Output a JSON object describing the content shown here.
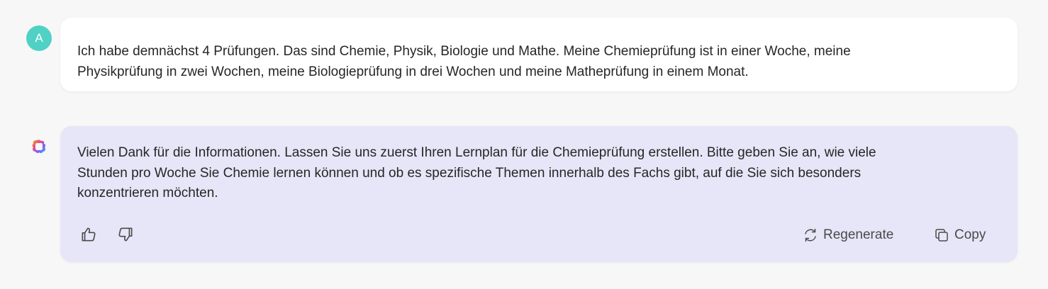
{
  "user": {
    "avatar_initial": "A",
    "message_line1": "Ich habe demnächst 4 Prüfungen. Das sind Chemie, Physik, Biologie und Mathe. Meine Chemieprüfung ist in einer Woche, meine",
    "message_line2": "Physikprüfung in zwei Wochen, meine Biologieprüfung in drei Wochen und meine Matheprüfung in einem Monat."
  },
  "assistant": {
    "logo_icon": "copilot-logo-icon",
    "message_line1": "Vielen Dank für die Informationen. Lassen Sie uns zuerst Ihren Lernplan für die Chemieprüfung erstellen. Bitte geben Sie an, wie viele",
    "message_line2": "Stunden pro Woche Sie Chemie lernen können und ob es spezifische Themen innerhalb des Fachs gibt, auf die Sie sich besonders",
    "message_line3": "konzentrieren möchten."
  },
  "actions": {
    "thumb_up_icon": "thumb-up-icon",
    "thumb_down_icon": "thumb-down-icon",
    "regenerate_label": "Regenerate",
    "copy_label": "Copy"
  },
  "colors": {
    "background": "#f7f7f8",
    "user_bubble": "#ffffff",
    "assistant_bubble": "#e7e6f8",
    "avatar": "#4fd1c5"
  }
}
